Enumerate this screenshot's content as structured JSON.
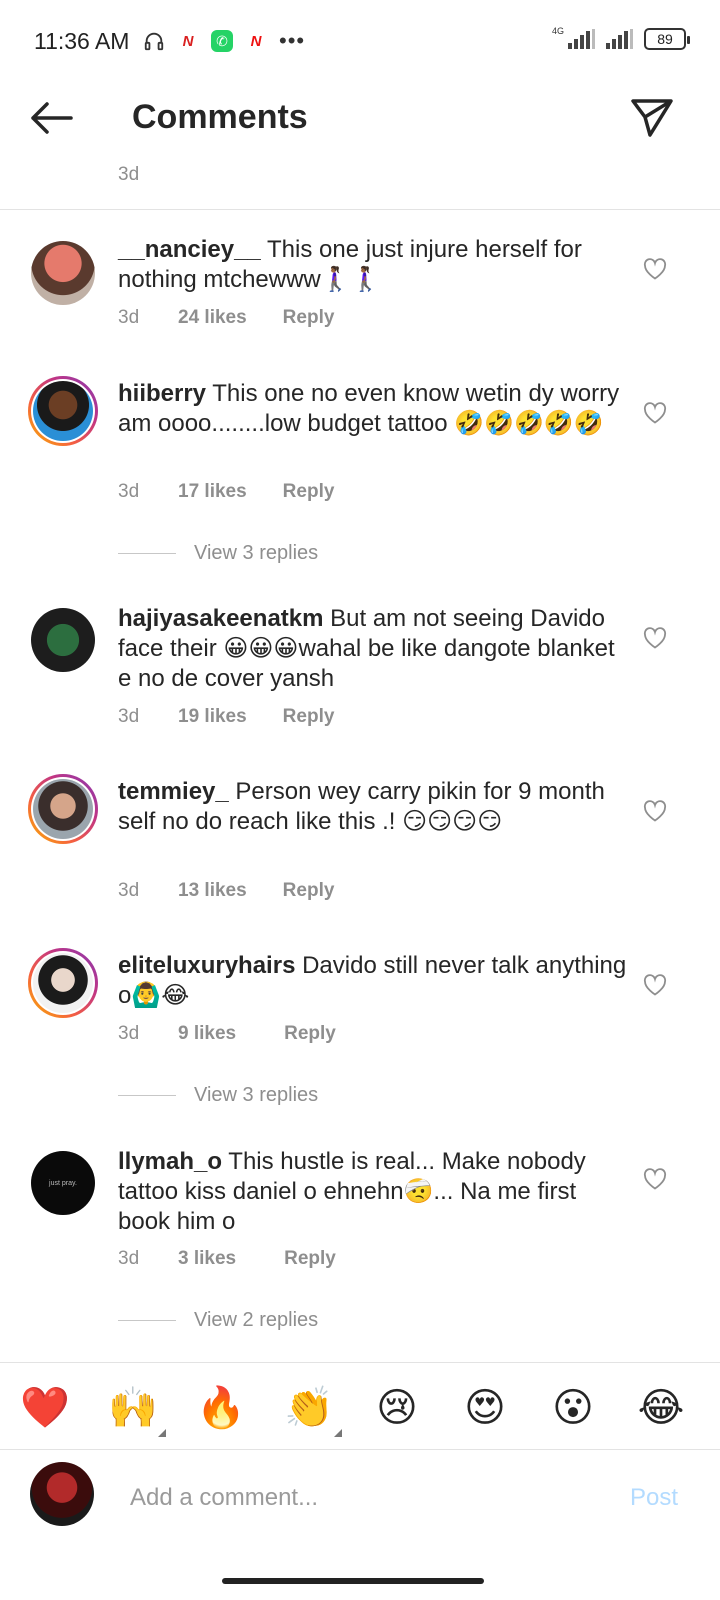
{
  "status_bar": {
    "time": "11:36 AM",
    "network": "4G",
    "battery": "89",
    "more": "•••"
  },
  "header": {
    "title": "Comments"
  },
  "previous_comment": {
    "time": "3d"
  },
  "comments": [
    {
      "username": "__nanciey__",
      "text": " This one just injure herself for nothing mtchewww🚶🏾‍♀️🚶🏾‍♀️",
      "time": "3d",
      "likes": "24 likes",
      "reply": "Reply"
    },
    {
      "username": "hiiberry",
      "text": " This one no even know wetin dy worry am oooo........low budget tattoo 🤣🤣🤣🤣🤣",
      "time": "3d",
      "likes": "17 likes",
      "reply": "Reply",
      "view_replies": "View 3 replies"
    },
    {
      "username": "hajiyasakeenatkm",
      "text": " But am not seeing Davido face their 😀😀😀wahal be like dangote blanket e no de cover yansh",
      "time": "3d",
      "likes": "19 likes",
      "reply": "Reply"
    },
    {
      "username": "temmiey_",
      "text": " Person wey carry pikin for 9 month self no do reach like this .! 😏😏😏😏",
      "time": "3d",
      "likes": "13 likes",
      "reply": "Reply"
    },
    {
      "username": "eliteluxuryhairs",
      "text": " Davido still never talk anything o🙆‍♂️😂",
      "time": "3d",
      "likes": "9 likes",
      "reply": "Reply",
      "view_replies": "View 3 replies"
    },
    {
      "username": "llymah_o",
      "text": " This hustle is real... Make nobody tattoo kiss daniel o ehnehn🤕... Na me first book him o",
      "time": "3d",
      "likes": "3 likes",
      "reply": "Reply",
      "view_replies": "View 2 replies",
      "avatar_text": "just pray."
    }
  ],
  "emoji_bar": [
    "❤️",
    "🙌",
    "🔥",
    "👏",
    "😢",
    "😍",
    "😮",
    "😂"
  ],
  "composer": {
    "placeholder": "Add a comment...",
    "post_label": "Post"
  },
  "colors": {
    "accent_disabled": "#b3dbff",
    "muted_text": "#8e8e8e",
    "primary_text": "#262626"
  }
}
